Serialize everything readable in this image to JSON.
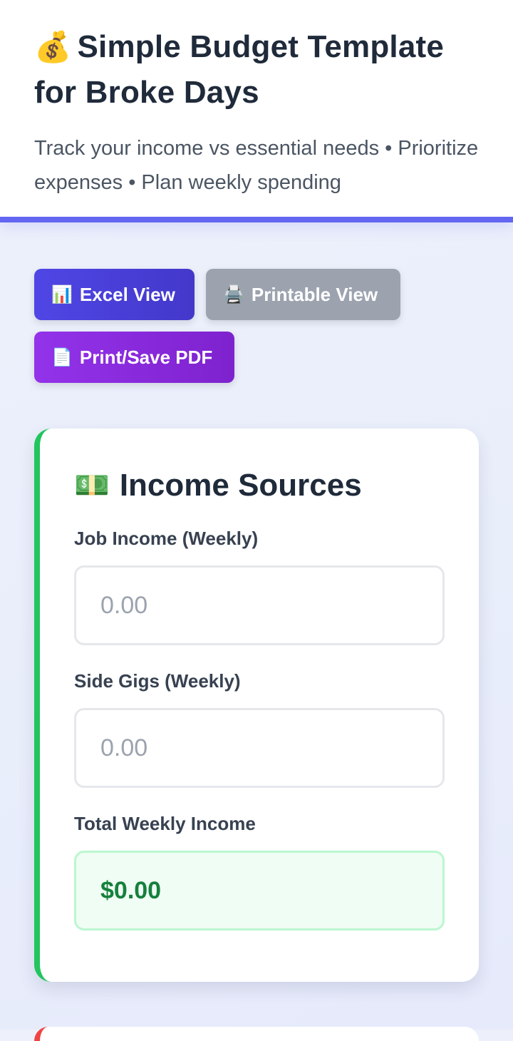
{
  "header": {
    "title_emoji": "💰",
    "title": "Simple Budget Template for Broke Days",
    "subtitle": "Track your income vs essential needs • Prioritize expenses • Plan weekly spending",
    "accent_color": "#6366f1"
  },
  "buttons": {
    "excel": {
      "icon": "📊",
      "label": "Excel View",
      "color": "#4f46e5"
    },
    "printable": {
      "icon": "🖨️",
      "label": "Printable View",
      "color": "#9ca3af"
    },
    "pdf": {
      "icon": "📄",
      "label": "Print/Save PDF",
      "color": "#9333ea"
    }
  },
  "income_card": {
    "icon": "💵",
    "title": "Income Sources",
    "accent_color": "#22c55e",
    "fields": [
      {
        "label": "Job Income (Weekly)",
        "value": "",
        "placeholder": "0.00"
      },
      {
        "label": "Side Gigs (Weekly)",
        "value": "",
        "placeholder": "0.00"
      }
    ],
    "total": {
      "label": "Total Weekly Income",
      "value": "$0.00",
      "color": "#15803d"
    }
  }
}
